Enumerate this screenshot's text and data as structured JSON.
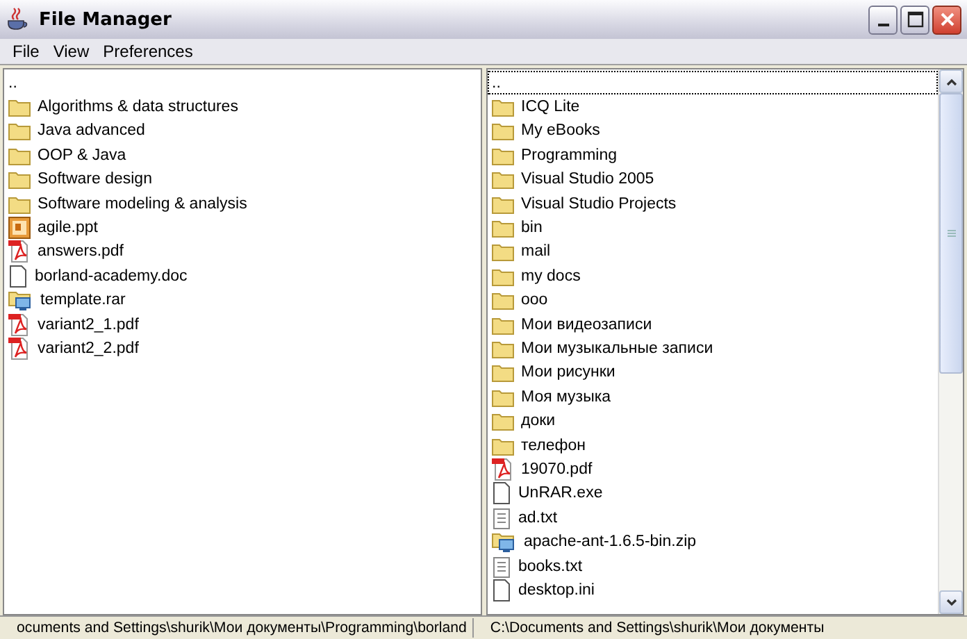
{
  "window": {
    "title": "File Manager"
  },
  "menu": [
    "File",
    "View",
    "Preferences"
  ],
  "left_panel": {
    "items": [
      {
        "name": "..",
        "kind": "parent",
        "selected": false
      },
      {
        "name": "Algorithms & data structures",
        "kind": "folder",
        "selected": false
      },
      {
        "name": "Java advanced",
        "kind": "folder",
        "selected": false
      },
      {
        "name": "OOP & Java",
        "kind": "folder",
        "selected": false
      },
      {
        "name": "Software design",
        "kind": "folder",
        "selected": false
      },
      {
        "name": "Software modeling & analysis",
        "kind": "folder",
        "selected": false
      },
      {
        "name": "agile.ppt",
        "kind": "ppt",
        "selected": false
      },
      {
        "name": "answers.pdf",
        "kind": "pdf",
        "selected": false
      },
      {
        "name": "borland-academy.doc",
        "kind": "file",
        "selected": false
      },
      {
        "name": "template.rar",
        "kind": "archive",
        "selected": false
      },
      {
        "name": "variant2_1.pdf",
        "kind": "pdf",
        "selected": false
      },
      {
        "name": "variant2_2.pdf",
        "kind": "pdf",
        "selected": false
      }
    ]
  },
  "right_panel": {
    "items": [
      {
        "name": "..",
        "kind": "parent",
        "selected": true
      },
      {
        "name": "ICQ Lite",
        "kind": "folder",
        "selected": false
      },
      {
        "name": "My eBooks",
        "kind": "folder",
        "selected": false
      },
      {
        "name": "Programming",
        "kind": "folder",
        "selected": false
      },
      {
        "name": "Visual Studio 2005",
        "kind": "folder",
        "selected": false
      },
      {
        "name": "Visual Studio Projects",
        "kind": "folder",
        "selected": false
      },
      {
        "name": "bin",
        "kind": "folder",
        "selected": false
      },
      {
        "name": "mail",
        "kind": "folder",
        "selected": false
      },
      {
        "name": "my docs",
        "kind": "folder",
        "selected": false
      },
      {
        "name": "ooo",
        "kind": "folder",
        "selected": false
      },
      {
        "name": "Мои видеозаписи",
        "kind": "folder",
        "selected": false
      },
      {
        "name": "Мои музыкальные записи",
        "kind": "folder",
        "selected": false
      },
      {
        "name": "Мои рисунки",
        "kind": "folder",
        "selected": false
      },
      {
        "name": "Моя музыка",
        "kind": "folder",
        "selected": false
      },
      {
        "name": "доки",
        "kind": "folder",
        "selected": false
      },
      {
        "name": "телефон",
        "kind": "folder",
        "selected": false
      },
      {
        "name": "19070.pdf",
        "kind": "pdf",
        "selected": false
      },
      {
        "name": "UnRAR.exe",
        "kind": "file",
        "selected": false
      },
      {
        "name": "ad.txt",
        "kind": "text",
        "selected": false
      },
      {
        "name": "apache-ant-1.6.5-bin.zip",
        "kind": "archive",
        "selected": false
      },
      {
        "name": "books.txt",
        "kind": "text",
        "selected": false
      },
      {
        "name": "desktop.ini",
        "kind": "file",
        "selected": false
      }
    ]
  },
  "status_bar": {
    "left_path": "ocuments and Settings\\shurik\\Мои документы\\Programming\\borland",
    "right_path": "C:\\Documents and Settings\\shurik\\Мои документы"
  }
}
